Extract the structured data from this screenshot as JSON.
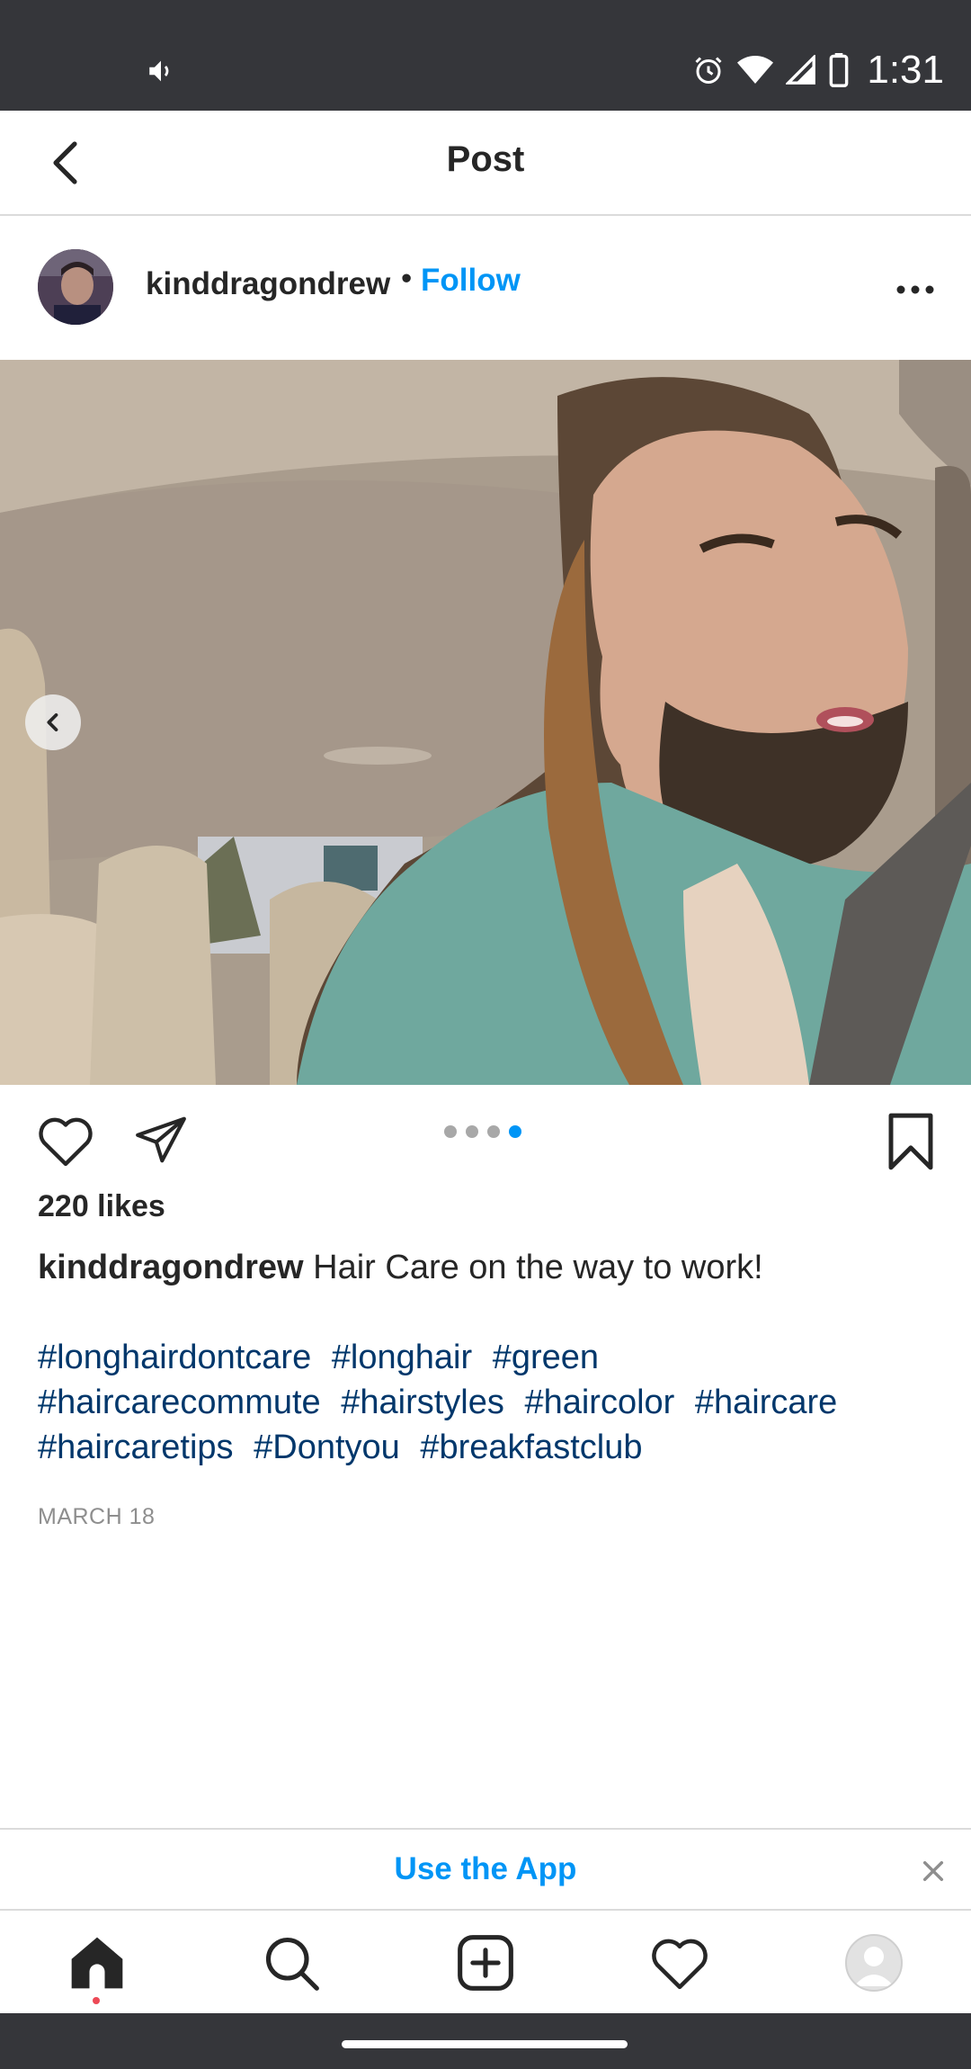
{
  "status_bar": {
    "time": "1:31",
    "icons": [
      "volume-icon",
      "alarm-icon",
      "wifi-icon",
      "signal-icon",
      "battery-icon"
    ]
  },
  "header": {
    "title": "Post",
    "back_icon": "chevron-left-icon"
  },
  "post": {
    "username": "kinddragondrew",
    "separator": "•",
    "follow_label": "Follow",
    "more_icon": "more-horizontal-icon",
    "carousel": {
      "count": 4,
      "active_index": 3,
      "prev_icon": "chevron-left-icon"
    },
    "likes_text": "220 likes",
    "caption": {
      "username": "kinddragondrew",
      "text": "Hair Care on the way to work!"
    },
    "hashtags": [
      "#longhairdontcare",
      "#longhair",
      "#green",
      "#haircarecommute",
      "#hairstyles",
      "#haircolor",
      "#haircare",
      "#haircaretips",
      "#Dontyou",
      "#breakfastclub"
    ],
    "date": "MARCH 18"
  },
  "banner": {
    "label": "Use the App",
    "close_icon": "close-icon"
  },
  "tab_bar": {
    "items": [
      "home-icon",
      "search-icon",
      "new-post-icon",
      "heart-icon",
      "profile-avatar"
    ]
  },
  "colors": {
    "accent": "#0095f6",
    "hashtag": "#00376b",
    "system_bar": "#35363a",
    "notification_dot": "#ed4956"
  }
}
